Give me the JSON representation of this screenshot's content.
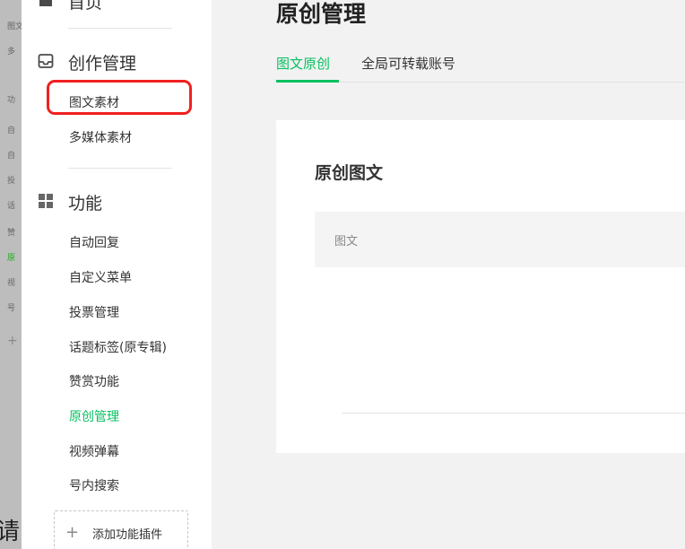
{
  "background": {
    "items": [
      "图文",
      "多",
      "功",
      "自",
      "自",
      "投",
      "话",
      "赞",
      "原",
      "视",
      "号"
    ],
    "active_index": 8,
    "plus": "+",
    "partial_text": "请问"
  },
  "sidebar": {
    "home": {
      "label": "首页",
      "icon": "home-icon"
    },
    "creation": {
      "label": "创作管理",
      "icon": "inbox-icon",
      "items": [
        {
          "label": "图文素材",
          "highlighted": true
        },
        {
          "label": "多媒体素材"
        }
      ]
    },
    "features": {
      "label": "功能",
      "icon": "grid-icon",
      "items": [
        {
          "label": "自动回复"
        },
        {
          "label": "自定义菜单"
        },
        {
          "label": "投票管理"
        },
        {
          "label": "话题标签(原专辑)"
        },
        {
          "label": "赞赏功能"
        },
        {
          "label": "原创管理",
          "active": true
        },
        {
          "label": "视频弹幕"
        },
        {
          "label": "号内搜索"
        }
      ]
    },
    "add_plugin": {
      "plus": "+",
      "label": "添加功能插件"
    }
  },
  "main": {
    "title": "原创管理",
    "tabs": [
      {
        "label": "图文原创",
        "active": true
      },
      {
        "label": "全局可转载账号"
      }
    ],
    "card": {
      "title": "原创图文",
      "table_header": "图文"
    }
  },
  "colors": {
    "accent": "#07c160",
    "highlight": "#f02020"
  }
}
